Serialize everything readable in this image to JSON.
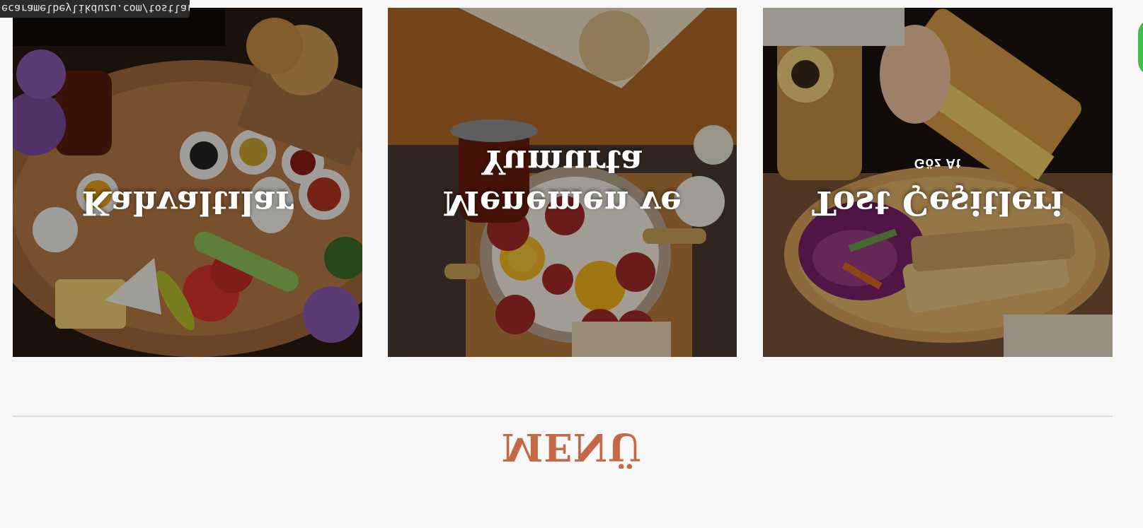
{
  "status_bar": {
    "url": "ecaramelbeylikduzu.com/tostlar/"
  },
  "cards": [
    {
      "title_line1": "Kahvaltılar",
      "title_line2": "",
      "cta": ""
    },
    {
      "title_line1": "Menemen ve",
      "title_line2": "Yumurta",
      "cta": ""
    },
    {
      "title_line1": "Tost Çeşitleri",
      "title_line2": "",
      "cta": "Göz At"
    }
  ],
  "section": {
    "title": "MENÜ"
  },
  "colors": {
    "accent": "#c46846",
    "page_bg": "#f7f7f7",
    "divider": "#dcdcdc",
    "overlay_text": "#ffffff",
    "widget": "#3fbf4a"
  }
}
